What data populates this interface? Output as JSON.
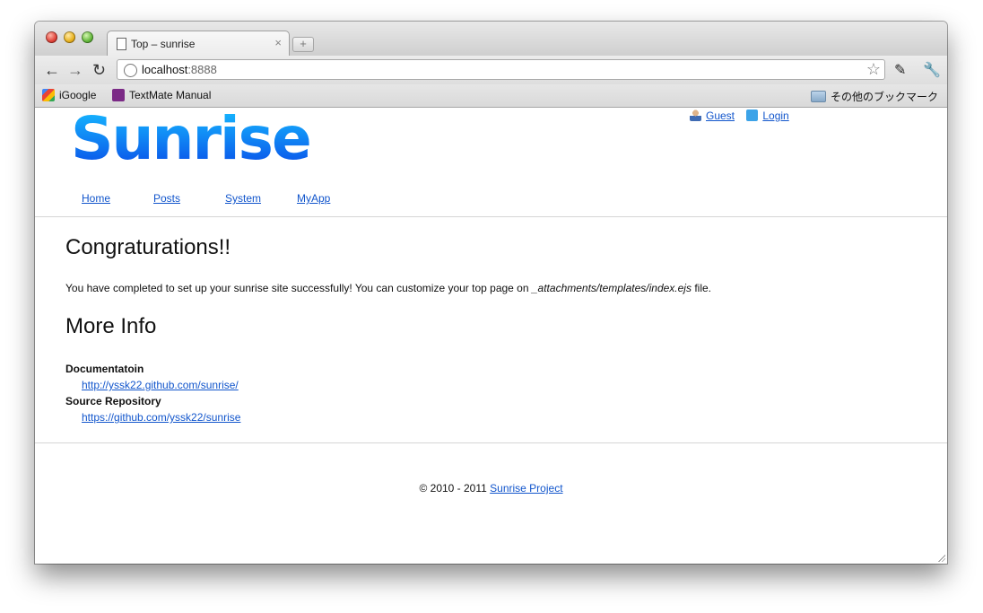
{
  "browser": {
    "tab_title": "Top – sunrise",
    "tab_close": "×",
    "new_tab": "+",
    "url_host": "localhost",
    "url_port": ":8888",
    "bookmarks": [
      {
        "label": "iGoogle",
        "icon": "igoogle-icon"
      },
      {
        "label": "TextMate Manual",
        "icon": "textmate-icon"
      }
    ],
    "other_bookmarks": "その他のブックマーク"
  },
  "site": {
    "logo_text": "Sunrise",
    "user": {
      "guest": "Guest",
      "login": "Login"
    },
    "nav": [
      "Home",
      "Posts",
      "System",
      "MyApp"
    ]
  },
  "main": {
    "heading": "Congraturations!!",
    "para_prefix": "You have completed to set up your sunrise site successfully! You can customize your top page on ",
    "para_path": "_attachments/templates/index.ejs",
    "para_suffix": " file.",
    "more_heading": "More Info",
    "info": [
      {
        "label": "Documentatoin",
        "link": "http://yssk22.github.com/sunrise/"
      },
      {
        "label": "Source Repository",
        "link": "https://github.com/yssk22/sunrise"
      }
    ]
  },
  "footer": {
    "copyright": "© 2010 - 2011 ",
    "link": "Sunrise Project"
  }
}
